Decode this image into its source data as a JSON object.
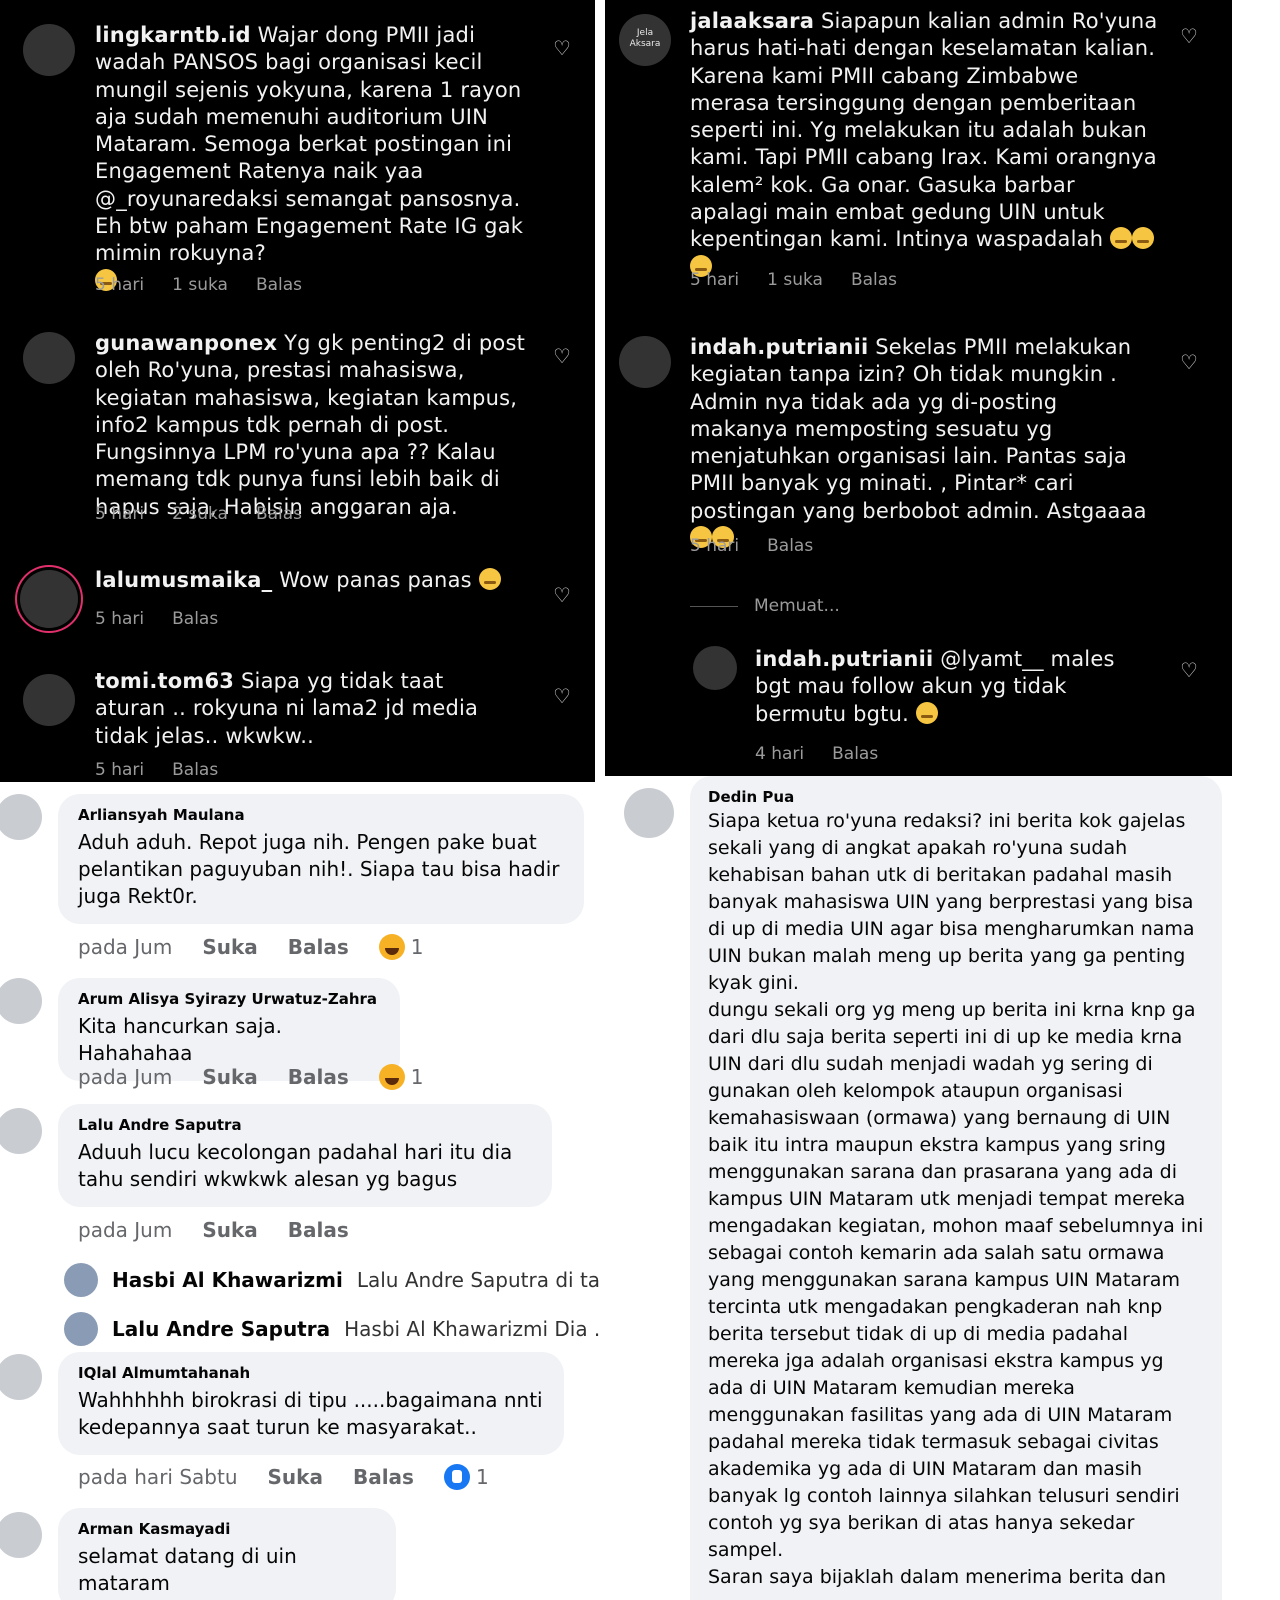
{
  "instagram_left": [
    {
      "user": "lingkarntb.id",
      "text": "Wajar dong PMII jadi wadah PANSOS bagi organisasi kecil mungil sejenis yokyuna, karena 1 rayon aja sudah memenuhi auditorium UIN Mataram. Semoga berkat postingan ini Engagement Ratenya naik yaa @_royunaredaksi semangat pansosnya. Eh btw paham Engagement Rate IG gak mimin rokuyna?",
      "time": "5 hari",
      "likes": "1 suka",
      "reply": "Balas"
    },
    {
      "user": "gunawanponex",
      "text": "Yg gk penting2 di post oleh Ro'yuna, prestasi mahasiswa, kegiatan mahasiswa, kegiatan kampus, info2 kampus tdk pernah di post. Fungsinnya LPM ro'yuna apa ?? Kalau memang tdk punya funsi lebih baik di hapus saja, Habisin anggaran aja.",
      "time": "5 hari",
      "likes": "2 suka",
      "reply": "Balas"
    },
    {
      "user": "lalumusmaika_",
      "text": "Wow panas panas",
      "time": "5 hari",
      "likes": "",
      "reply": "Balas"
    },
    {
      "user": "tomi.tom63",
      "text": "Siapa yg tidak taat aturan .. rokyuna ni lama2 jd media tidak jelas.. wkwkw..",
      "time": "5 hari",
      "likes": "",
      "reply": "Balas"
    }
  ],
  "instagram_right": [
    {
      "user": "jalaaksara",
      "avatar_text": "Jela Aksara",
      "text": "Siapapun kalian admin Ro'yuna harus hati-hati dengan keselamatan kalian. Karena kami PMII cabang Zimbabwe merasa tersinggung dengan pemberitaan seperti ini. Yg melakukan itu adalah bukan kami. Tapi PMII cabang Irax. Kami orangnya kalem² kok. Ga onar. Gasuka barbar apalagi main embat gedung UIN untuk kepentingan kami. Intinya waspadalah",
      "time": "5 hari",
      "likes": "1 suka",
      "reply": "Balas"
    },
    {
      "user": "indah.putrianii",
      "text": "Sekelas PMII melakukan kegiatan tanpa izin? Oh tidak mungkin . Admin nya tidak ada yg di-posting makanya memposting sesuatu yg menjatuhkan organisasi lain. Pantas saja PMII banyak yg minati. , Pintar* cari postingan yang berbobot admin. Astgaaaa",
      "time": "5 hari",
      "likes": "",
      "reply": "Balas"
    },
    {
      "user": "indah.putrianii",
      "text": "@lyamt__ males bgt mau follow akun yg tidak bermutu bgtu.",
      "time": "4 hari",
      "likes": "",
      "reply": "Balas"
    }
  ],
  "loading_text": "Memuat...",
  "facebook_left": [
    {
      "name": "Arliansyah Maulana",
      "text": "Aduh aduh. Repot juga nih. Pengen pake buat pelantikan paguyuban nih!. Siapa tau bisa hadir juga Rekt0r.",
      "time": "pada Jum",
      "like": "Suka",
      "reply": "Balas",
      "react_count": "1"
    },
    {
      "name": "Arum Alisya Syirazy Urwatuz-Zahra",
      "text": "Kita hancurkan saja. Hahahahaa",
      "time": "pada Jum",
      "like": "Suka",
      "reply": "Balas",
      "react_count": "1"
    },
    {
      "name": "Lalu Andre Saputra",
      "text": "Aduuh lucu kecolongan padahal hari itu dia tahu sendiri wkwkwk alesan yg bagus",
      "time": "pada Jum",
      "like": "Suka",
      "reply": "Balas",
      "react_count": ""
    },
    {
      "name": "IQlal Almumtahanah",
      "text": "Wahhhhhh birokrasi di tipu .....bagaimana nnti kedepannya saat turun ke masyarakat..",
      "time": "pada hari Sabtu",
      "like": "Suka",
      "reply": "Balas",
      "react_count": "1"
    },
    {
      "name": "Arman Kasmayadi",
      "text": "selamat datang di uin mataram",
      "time": "",
      "like": "",
      "reply": "",
      "react_count": ""
    }
  ],
  "facebook_replies": [
    {
      "name": "Hasbi Al Khawarizmi",
      "text": "Lalu Andre Saputra di ta..."
    },
    {
      "name": "Lalu Andre Saputra",
      "text": "Hasbi Al Khawarizmi Dia ..."
    }
  ],
  "facebook_right": {
    "name": "Dedin Pua",
    "text": "Siapa ketua ro'yuna redaksi? ini berita kok gajelas sekali yang di angkat apakah ro'yuna sudah kehabisan bahan utk di beritakan padahal masih banyak mahasiswa UIN yang berprestasi yang bisa di up di media UIN agar bisa mengharumkan nama UIN bukan malah meng up berita yang ga penting kyak gini.",
    "text2": "dungu sekali org yg meng up berita ini krna knp ga dari dlu saja berita seperti ini di up ke media krna UIN dari dlu sudah menjadi wadah yg sering di gunakan oleh kelompok ataupun organisasi kemahasiswaan (ormawa) yang bernaung di UIN baik itu intra maupun ekstra kampus yang sring menggunakan sarana dan prasarana yang ada di kampus UIN Mataram utk menjadi tempat mereka mengadakan kegiatan, mohon maaf sebelumnya ini sebagai contoh kemarin ada salah satu ormawa yang menggunakan sarana kampus UIN Mataram tercinta utk mengadakan pengkaderan nah knp berita tersebut tidak di up di media padahal mereka jga adalah organisasi ekstra kampus yg ada di UIN Mataram kemudian mereka menggunakan fasilitas yang ada di UIN Mataram padahal mereka tidak termasuk sebagai civitas akademika yg ada di UIN Mataram dan masih banyak lg contoh lainnya silahkan telusuri sendiri contoh yg sya berikan di atas hanya sekedar sampel.",
    "text3": "Saran saya bijaklah dalam menerima berita dan"
  },
  "colors": {
    "instagram_bg": "#000000",
    "facebook_bg": "#ffffff",
    "bubble": "#f0f2f5",
    "meta_gray": "#9b9b9b",
    "fb_gray": "#65676b"
  }
}
